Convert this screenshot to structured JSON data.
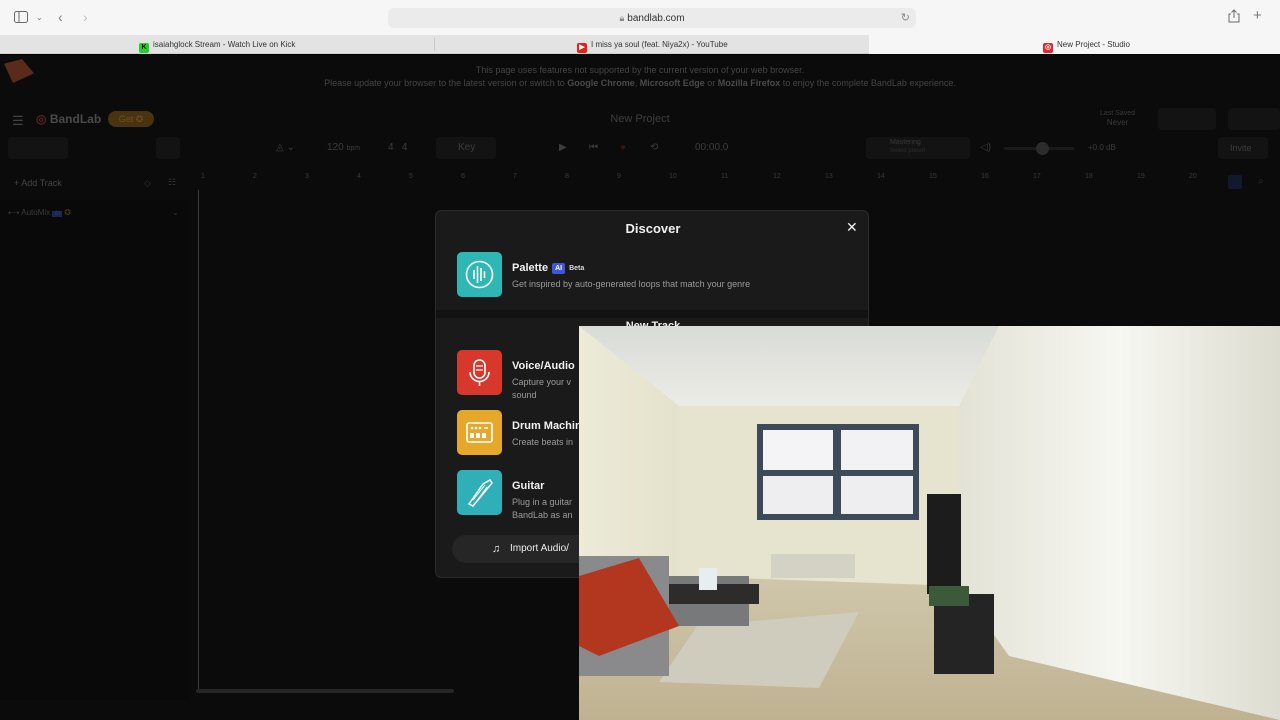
{
  "browser": {
    "url": "bandlab.com",
    "tabs": [
      {
        "label": "isaiahglock Stream - Watch Live on Kick",
        "icon": "kick-favicon"
      },
      {
        "label": "I miss ya soul (feat. Niya2x) - YouTube",
        "icon": "youtube-favicon"
      },
      {
        "label": "New Project - Studio",
        "icon": "bandlab-favicon"
      }
    ]
  },
  "banner": {
    "line1": "This page uses features not supported by the current version of your web browser.",
    "line2_pre": "Please update your browser to the latest version or switch to ",
    "chrome": "Google Chrome",
    "sep1": ", ",
    "edge": "Microsoft Edge",
    "sep2": " or ",
    "firefox": "Mozilla Firefox",
    "line2_post": " to enjoy the complete BandLab experience."
  },
  "studio": {
    "brand": "BandLab",
    "get": "Get",
    "project_title": "New Project",
    "last_saved_label": "Last Saved",
    "last_saved_value": "Never",
    "bpm": "120",
    "bpm_unit": "bpm",
    "time_sig_top": "4",
    "time_sig_bottom": "4",
    "key": "Key",
    "time": "00:00.0",
    "mastering": "Mastering",
    "mastering_sub": "Select preset",
    "volume_db": "+0.0 dB",
    "invite": "Invite",
    "add_track": "Add Track",
    "automix": "AutoMix",
    "ruler": [
      "1",
      "2",
      "3",
      "4",
      "5",
      "6",
      "7",
      "8",
      "9",
      "10",
      "11",
      "12",
      "13",
      "14",
      "15",
      "16",
      "17",
      "18",
      "19",
      "20"
    ]
  },
  "modal": {
    "title": "Discover",
    "palette": {
      "name": "Palette",
      "ai": "AI",
      "beta": "Beta",
      "desc": "Get inspired by auto-generated loops that match your genre"
    },
    "section_title": "New Track",
    "voice": {
      "name": "Voice/Audio",
      "desc1": "Capture your v",
      "desc2": "sound"
    },
    "drum": {
      "name": "Drum Machin",
      "desc1": "Create beats in"
    },
    "guitar": {
      "name": "Guitar",
      "desc1": "Plug in a guitar",
      "desc2": "BandLab as an"
    },
    "import_label": "Import Audio/"
  },
  "colors": {
    "palette_icon": "#2fb7b5",
    "voice_icon": "#d8382c",
    "drum_icon": "#e6a82a",
    "guitar_icon": "#2fb0b8"
  }
}
